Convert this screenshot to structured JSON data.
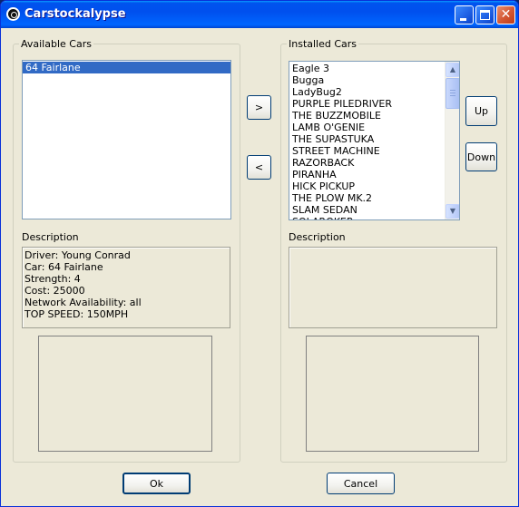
{
  "window": {
    "title": "Carstockalypse",
    "controls": {
      "minimize": "minimize",
      "maximize": "maximize",
      "close": "✕"
    }
  },
  "available": {
    "group_label": "Available Cars",
    "items": [
      "64 Fairlane"
    ],
    "selected_index": 0,
    "description_label": "Description",
    "description_lines": [
      "Driver: Young Conrad",
      "Car: 64 Fairlane",
      "Strength: 4",
      "Cost: 25000",
      "Network Availability: all",
      "TOP SPEED: 150MPH"
    ]
  },
  "installed": {
    "group_label": "Installed Cars",
    "items": [
      "Eagle 3",
      "Bugga",
      "LadyBug2",
      "PURPLE PILEDRIVER",
      "THE BUZZMOBILE",
      "LAMB O'GENIE",
      "THE SUPASTUKA",
      "STREET MACHINE",
      "RAZORBACK",
      "PIRANHA",
      "HICK PICKUP",
      "THE PLOW MK.2",
      "SLAM SEDAN",
      "SOLAROKER"
    ],
    "description_label": "Description",
    "description_lines": []
  },
  "transfer": {
    "add_label": ">",
    "remove_label": "<"
  },
  "order": {
    "up_label": "Up",
    "down_label": "Down"
  },
  "footer": {
    "ok_label": "Ok",
    "cancel_label": "Cancel"
  }
}
